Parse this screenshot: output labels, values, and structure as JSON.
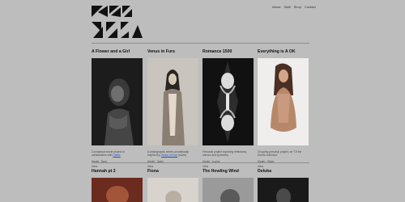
{
  "site": {
    "nav": [
      "About",
      "Staff",
      "Shop",
      "Contact"
    ]
  },
  "posts": [
    {
      "title": "A Flower and a Girl",
      "desc_text": "Conceptual movie project in collaboration with ",
      "desc_link": "Olivier",
      "meta": "Model : Sara",
      "more": "View"
    },
    {
      "title": "Venus in Furs",
      "desc_text": "A photographic series conceptually inspired by ",
      "desc_link": "Venus in Furs",
      "desc_after": " (novel)",
      "meta": "Model : Gaby",
      "more": "View"
    },
    {
      "title": "Romance 1500",
      "desc_text": "Personal project exploring reflections, mirrors and symmetry",
      "meta": "Model : Lucine",
      "more": "View"
    },
    {
      "title": "Everything is A OK",
      "desc_text": "On going personal project, on \"Of the Demis collection\"",
      "meta": "Model : Olivia",
      "more": "View"
    }
  ],
  "posts_row2": [
    {
      "title": "Hannah pt 2"
    },
    {
      "title": "Fiona"
    },
    {
      "title": "The Howling Wind"
    },
    {
      "title": "Deluka"
    }
  ]
}
